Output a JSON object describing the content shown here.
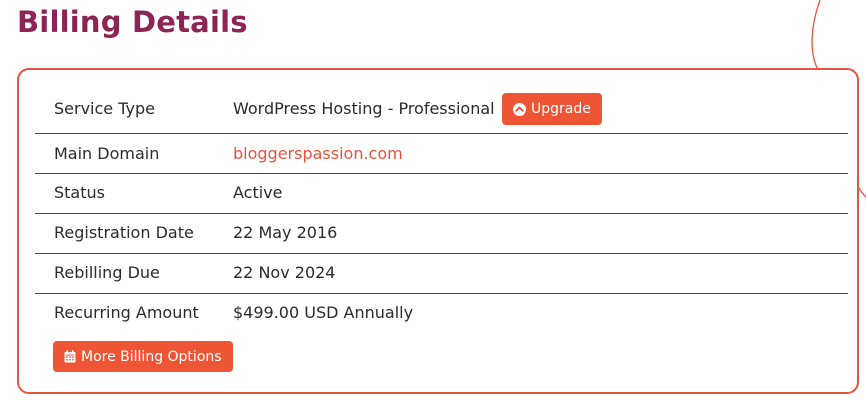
{
  "page": {
    "title": "Billing Details"
  },
  "details": {
    "rows": [
      {
        "label": "Service Type",
        "value": "WordPress Hosting - Professional"
      },
      {
        "label": "Main Domain",
        "value": "bloggerspassion.com"
      },
      {
        "label": "Status",
        "value": "Active"
      },
      {
        "label": "Registration Date",
        "value": "22 May 2016"
      },
      {
        "label": "Rebilling Due",
        "value": "22 Nov 2024"
      },
      {
        "label": "Recurring Amount",
        "value": "$499.00 USD Annually"
      }
    ],
    "upgrade_button": {
      "label": "Upgrade",
      "icon": "arrow-up-circle-icon"
    },
    "more_button": {
      "label": "More Billing Options",
      "icon": "calendar-icon"
    }
  },
  "colors": {
    "title": "#8e2455",
    "accent": "#e7533d",
    "button": "#ee5535",
    "divider": "#8e2455",
    "text": "#2b2b2b"
  }
}
